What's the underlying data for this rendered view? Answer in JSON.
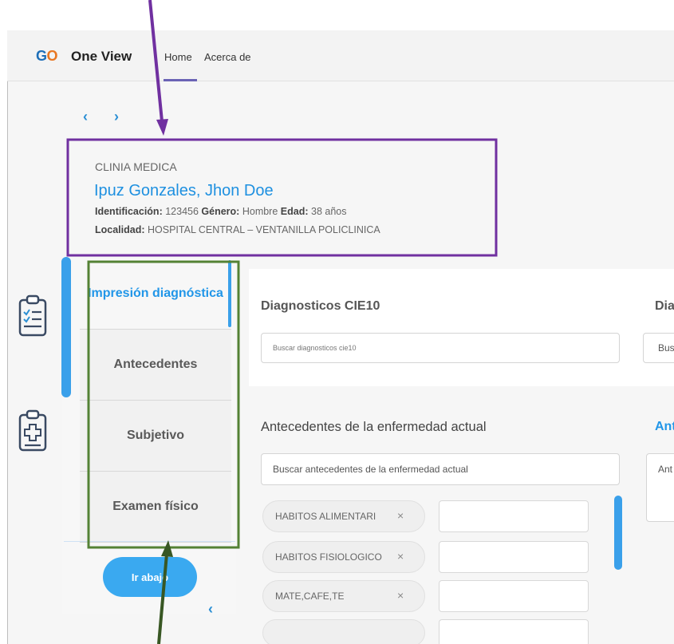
{
  "header": {
    "logo_g": "G",
    "logo_o": "O",
    "app_title": "One View",
    "nav": {
      "home": "Home",
      "about": "Acerca de"
    }
  },
  "history_nav": {
    "back": "‹",
    "forward": "›"
  },
  "patient": {
    "clinic": "CLINIA MEDICA",
    "name": "Ipuz Gonzales, Jhon Doe",
    "id_label": "Identificación:",
    "id_value": "123456",
    "gender_label": "Género:",
    "gender_value": "Hombre",
    "age_label": "Edad:",
    "age_value": "38 años",
    "location_label": "Localidad:",
    "location_value": "HOSPITAL CENTRAL – VENTANILLA POLICLINICA"
  },
  "tabs": [
    {
      "label": "Impresión diagnóstica",
      "active": true
    },
    {
      "label": "Antecedentes",
      "active": false
    },
    {
      "label": "Subjetivo",
      "active": false
    },
    {
      "label": "Examen físico",
      "active": false
    }
  ],
  "go_down_button": "Ir abajo",
  "collapse": "‹",
  "diagnosis": {
    "title": "Diagnosticos CIE10",
    "search_placeholder": "Buscar diagnosticos cie10",
    "right_title": "Diag",
    "right_placeholder": "Bus"
  },
  "history": {
    "title": "Antecedentes de la enfermedad actual",
    "search_placeholder": "Buscar antecedentes de la enfermedad actual",
    "right_title": "Ante",
    "right_placeholder": "Ant",
    "chips": [
      {
        "label": "HABITOS ALIMENTARI",
        "remove": "×"
      },
      {
        "label": "HABITOS FISIOLOGICO",
        "remove": "×"
      },
      {
        "label": "MATE,CAFE,TE",
        "remove": "×"
      }
    ]
  },
  "annotation_colors": {
    "patient_box": "#7030a0",
    "tabs_box": "#548235",
    "arrow_top": "#7030a0",
    "arrow_bottom": "#385723"
  }
}
